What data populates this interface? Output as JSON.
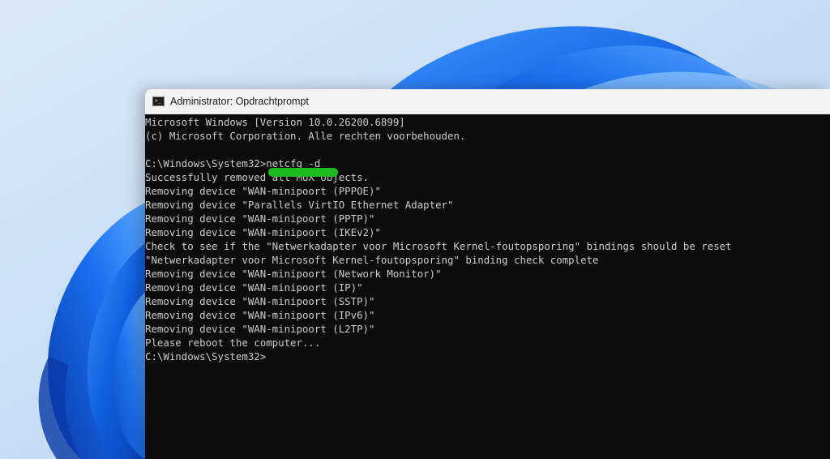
{
  "window": {
    "title": "Administrator: Opdrachtprompt",
    "icon": "cmd-icon"
  },
  "console": {
    "lines": [
      "Microsoft Windows [Version 10.0.26200.6899]",
      "(c) Microsoft Corporation. Alle rechten voorbehouden.",
      "",
      "C:\\Windows\\System32>netcfg -d",
      "Successfully removed all MUX Objects.",
      "Removing device \"WAN-minipoort (PPPOE)\"",
      "Removing device \"Parallels VirtIO Ethernet Adapter\"",
      "Removing device \"WAN-minipoort (PPTP)\"",
      "Removing device \"WAN-minipoort (IKEv2)\"",
      "Check to see if the \"Netwerkadapter voor Microsoft Kernel-foutopsporing\" bindings should be reset",
      "\"Netwerkadapter voor Microsoft Kernel-foutopsporing\" binding check complete",
      "Removing device \"WAN-minipoort (Network Monitor)\"",
      "Removing device \"WAN-minipoort (IP)\"",
      "Removing device \"WAN-minipoort (SSTP)\"",
      "Removing device \"WAN-minipoort (IPv6)\"",
      "Removing device \"WAN-minipoort (L2TP)\"",
      "Please reboot the computer...",
      "C:\\Windows\\System32>"
    ]
  },
  "colors": {
    "console_bg": "#0c0c0c",
    "console_text": "#cccccc",
    "titlebar_bg": "#f3f3f3",
    "highlight": "#20b820",
    "wallpaper_blue": "#1b6fe0"
  }
}
